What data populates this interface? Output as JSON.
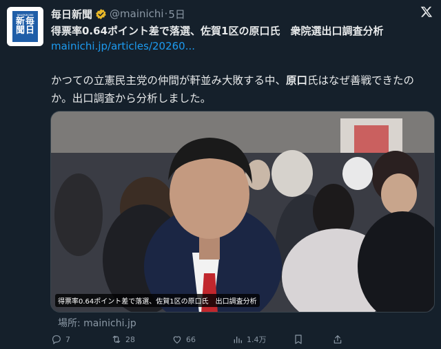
{
  "account": {
    "avatar_text": [
      "新",
      "毎",
      "聞",
      "日"
    ],
    "avatar_small": "MAINICHI",
    "name": "毎日新聞",
    "handle": "@mainichi",
    "separator": "·",
    "time": "5日"
  },
  "card": {
    "title_part1": "得票率0.64ポイント差で落選、佐賀1区の",
    "title_hl": "原口",
    "title_part2": "氏　衆院選出口調査分析",
    "link": "mainichi.jp/articles/20260..."
  },
  "text": {
    "line1_a": "かつての立憲民主党の仲間が軒並み大敗する中、",
    "line1_hl": "原口",
    "line1_b": "氏はなぜ善戦できたの",
    "line2": "か。出口調査から分析しました。"
  },
  "media": {
    "caption": "得票率0.64ポイント差で落選、佐賀1区の原口氏　出口調査分析"
  },
  "source": "場所: mainichi.jp",
  "actions": {
    "replies": "7",
    "reposts": "28",
    "likes": "66",
    "views": "1.4万"
  },
  "colors": {
    "background": "#15202b",
    "link": "#1d9bf0",
    "muted": "#8b98a5",
    "verified": "#e8b829"
  }
}
